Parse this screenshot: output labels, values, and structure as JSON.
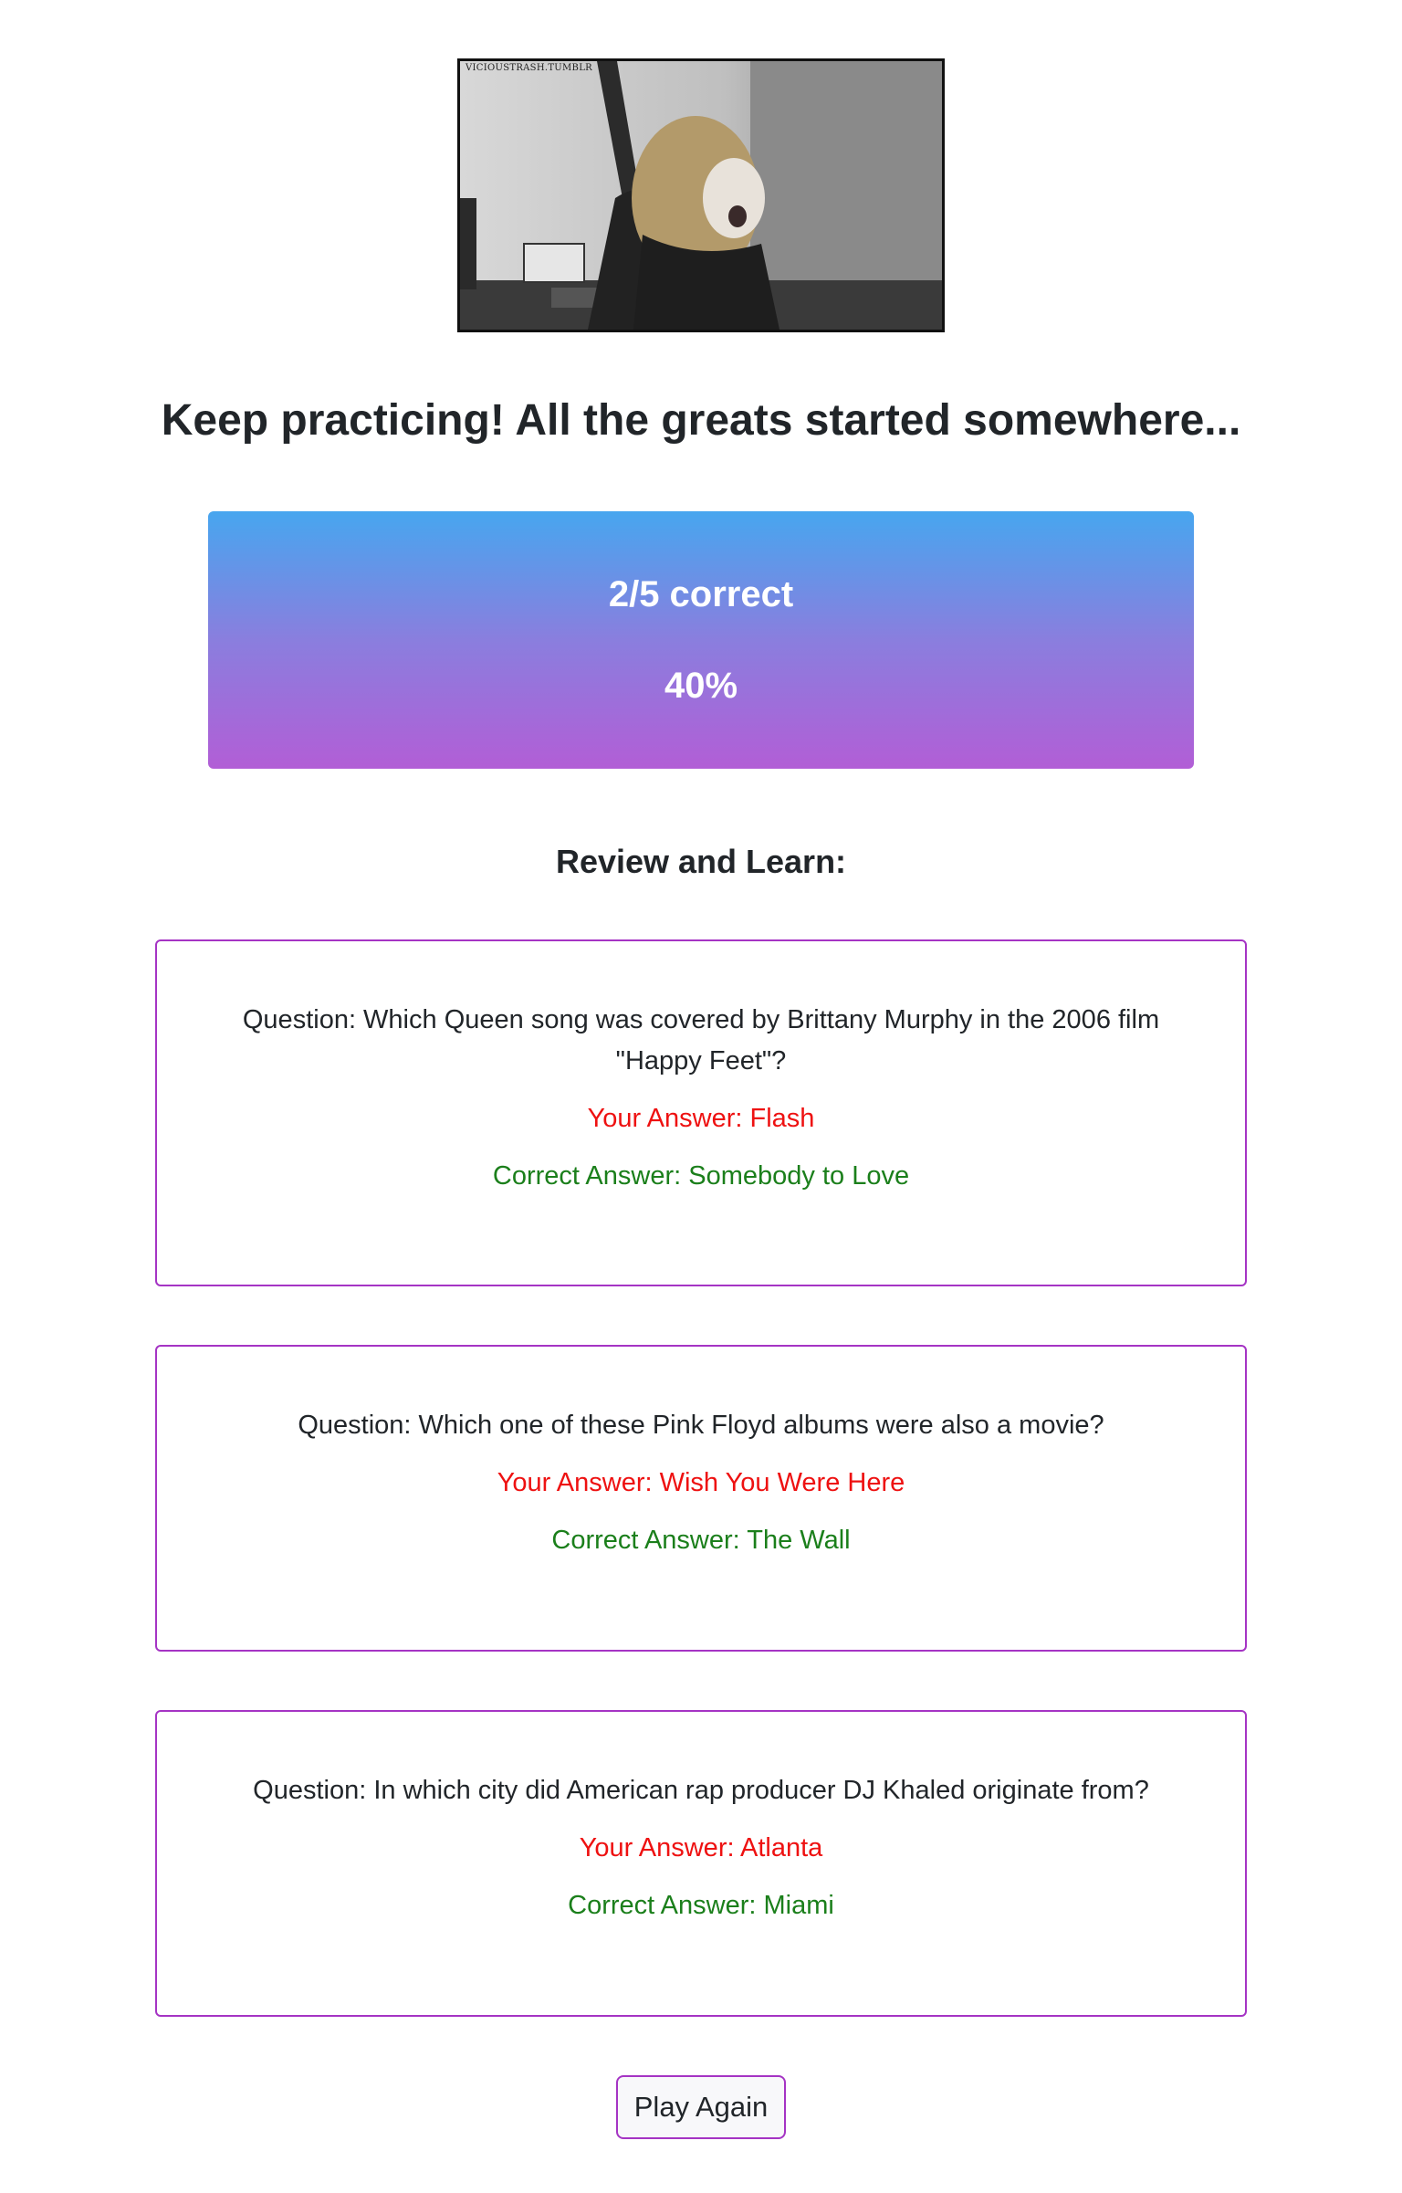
{
  "hero_image": {
    "watermark": "VICIOUSTRASH.TUMBLR"
  },
  "headline": "Keep practicing! All the greats started somewhere...",
  "score": {
    "line": "2/5 correct",
    "percent": "40%",
    "correct": 2,
    "total": 5
  },
  "review": {
    "title": "Review and Learn:",
    "items": [
      {
        "question": "Question: Which Queen song was covered by Brittany Murphy in the 2006 film \"Happy Feet\"?",
        "your_answer": "Your Answer: Flash",
        "correct_answer": "Correct Answer: Somebody to Love"
      },
      {
        "question": "Question: Which one of these Pink Floyd albums were also a movie?",
        "your_answer": "Your Answer: Wish You Were Here",
        "correct_answer": "Correct Answer: The Wall"
      },
      {
        "question": "Question: In which city did American rap producer DJ Khaled originate from?",
        "your_answer": "Your Answer: Atlanta",
        "correct_answer": "Correct Answer: Miami"
      }
    ]
  },
  "play_again_label": "Play Again",
  "colors": {
    "card_border": "#a534c4",
    "wrong_answer": "#ee1111",
    "correct_answer": "#1b7f1b",
    "gradient_top": "#47a6ef",
    "gradient_bottom": "#b25ed6"
  }
}
